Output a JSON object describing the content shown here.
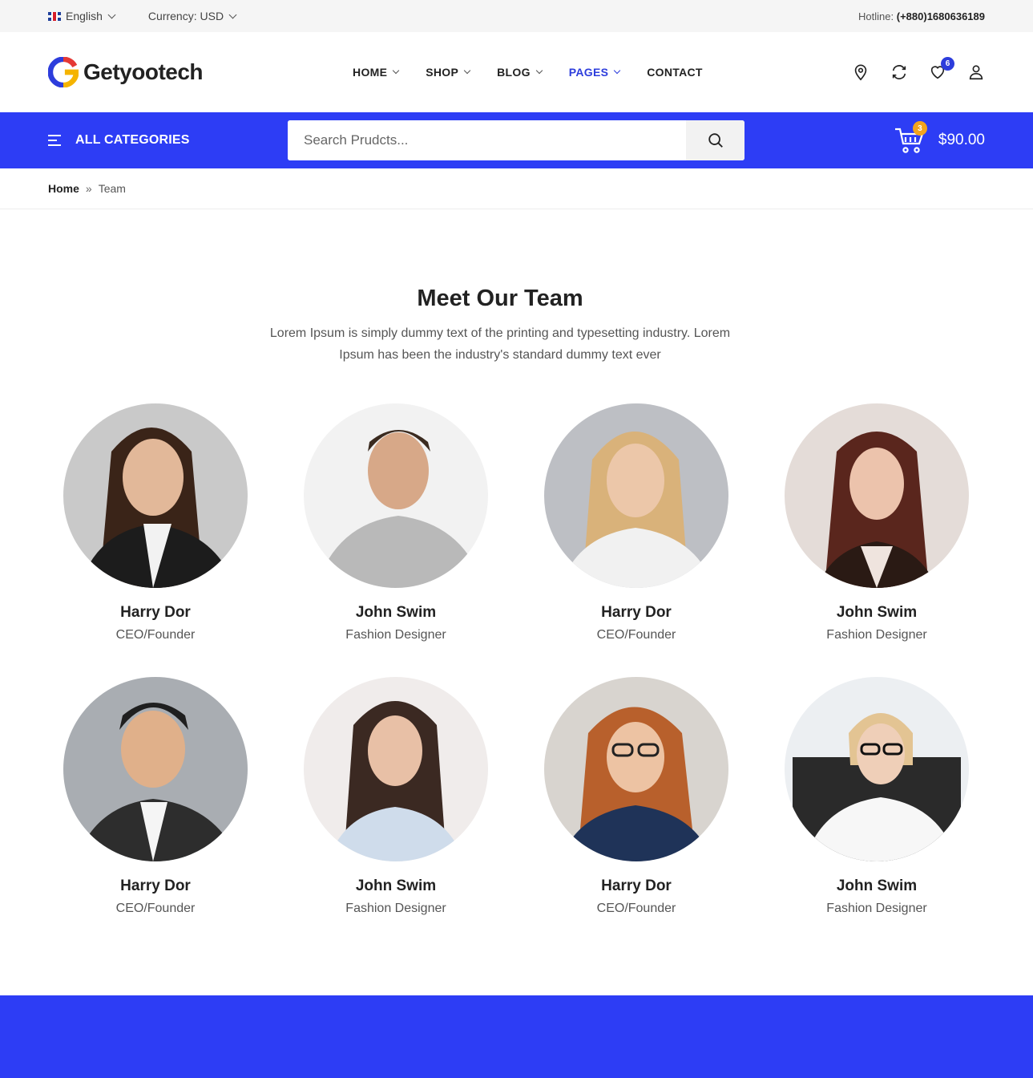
{
  "topbar": {
    "language": "English",
    "currency": "Currency: USD",
    "hotline_label": "Hotline:",
    "hotline_number": "(+880)1680636189"
  },
  "header": {
    "logo_text": "Getyootech",
    "nav": [
      {
        "label": "HOME",
        "dropdown": true
      },
      {
        "label": "SHOP",
        "dropdown": true
      },
      {
        "label": "BLOG",
        "dropdown": true
      },
      {
        "label": "PAGES",
        "dropdown": true,
        "active": true
      },
      {
        "label": "CONTACT",
        "dropdown": false
      }
    ],
    "wishlist_count": "6"
  },
  "bluebar": {
    "all_categories": "ALL CATEGORIES",
    "search_placeholder": "Search Prudcts...",
    "cart_count": "3",
    "cart_total": "$90.00"
  },
  "breadcrumb": {
    "home": "Home",
    "separator": "»",
    "current": "Team"
  },
  "section": {
    "title": "Meet Our Team",
    "description": "Lorem Ipsum is simply dummy text of the printing and typesetting industry. Lorem Ipsum has been the industry's standard dummy text ever"
  },
  "team": [
    {
      "name": "Harry Dor",
      "role": "CEO/Founder"
    },
    {
      "name": "John Swim",
      "role": "Fashion Designer"
    },
    {
      "name": "Harry Dor",
      "role": "CEO/Founder"
    },
    {
      "name": "John Swim",
      "role": "Fashion Designer"
    },
    {
      "name": "Harry Dor",
      "role": "CEO/Founder"
    },
    {
      "name": "John Swim",
      "role": "Fashion Designer"
    },
    {
      "name": "Harry Dor",
      "role": "CEO/Founder"
    },
    {
      "name": "John Swim",
      "role": "Fashion Designer"
    }
  ],
  "colors": {
    "brand_blue": "#2d3df5",
    "nav_active": "#2d3ddc",
    "cart_badge": "#f3a41d",
    "logo_red": "#e53935",
    "logo_yellow": "#f5b400",
    "logo_blue": "#2d3ddc"
  },
  "icons": {
    "location": "map-pin-icon",
    "compare": "refresh-icon",
    "wishlist": "heart-icon",
    "account": "user-icon",
    "menu": "hamburger-icon",
    "search": "search-icon",
    "cart": "cart-icon"
  }
}
